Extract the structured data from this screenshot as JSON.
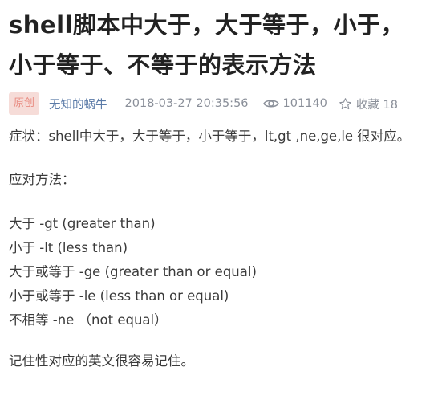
{
  "article": {
    "title": "shell脚本中大于，大于等于，小于，小于等于、不等于的表示方法",
    "badge": "原创",
    "author": "无知的蜗牛",
    "datetime": "2018-03-27 20:35:56",
    "views": "101140",
    "collect_label": "收藏 18"
  },
  "content": {
    "symptom": "症状：shell中大于，大于等于，小于等于，lt,gt ,ne,ge,le 很对应。",
    "method_heading": "应对方法：",
    "items": [
      "大于 -gt (greater than)",
      "小于 -lt (less than)",
      "大于或等于 -ge (greater than or equal)",
      "小于或等于 -le (less than or equal)",
      "不相等 -ne （not equal）"
    ],
    "note": "记住性对应的英文很容易记住。"
  },
  "icons": {
    "views": "eye-icon",
    "collect": "star-icon"
  },
  "colors": {
    "badge_bg": "#f6dcd8",
    "badge_text": "#e98e84",
    "author": "#5b7ba8",
    "meta": "#8a8f99"
  }
}
